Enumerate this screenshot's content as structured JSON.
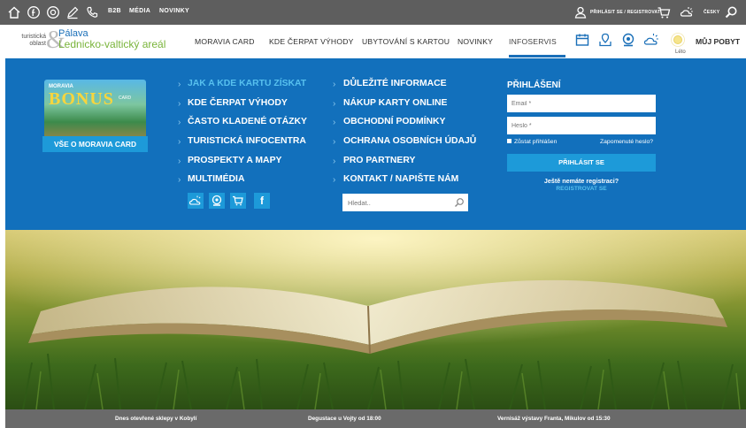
{
  "topbar": {
    "icons": [
      "home-icon",
      "facebook-icon",
      "instagram-icon",
      "pencil-icon",
      "phone-icon"
    ],
    "b2b": "B2B",
    "media": "MÉDIA",
    "novinky": "NOVINKY",
    "login_register": "PŘIHLÁSIT SE / REGISTROVAT",
    "weather_lang": "ČESKY"
  },
  "header": {
    "logo_small_1": "turistická",
    "logo_small_2": "oblast",
    "logo_amp": "&",
    "logo_line1": "Pálava",
    "logo_line2": "Lednicko-valtický areál",
    "nav": [
      "MORAVIA CARD",
      "KDE ČERPAT VÝHODY",
      "UBYTOVÁNÍ S KARTOU",
      "NOVINKY",
      "INFOSERVIS"
    ],
    "season": "Léto",
    "my_stay": "MŮJ POBYT"
  },
  "mega": {
    "card": {
      "top": "MORAVIA",
      "bonus": "BONUS",
      "caro": "CARD",
      "caption": "VŠE O MORAVIA CARD"
    },
    "col1": [
      "JAK A KDE KARTU ZÍSKAT",
      "KDE ČERPAT VÝHODY",
      "ČASTO KLADENÉ OTÁZKY",
      "TURISTICKÁ INFOCENTRA",
      "PROSPEKTY A MAPY",
      "MULTIMÉDIA"
    ],
    "col2": [
      "DŮLEŽITÉ INFORMACE",
      "NÁKUP KARTY ONLINE",
      "OBCHODNÍ PODMÍNKY",
      "OCHRANA OSOBNÍCH ÚDAJŮ",
      "PRO PARTNERY",
      "KONTAKT / NAPIŠTE NÁM"
    ],
    "social_icons": [
      "weather-icon",
      "webcam-icon",
      "cart-icon",
      "facebook-icon"
    ],
    "facebook_glyph": "f",
    "search_placeholder": "Hledat..",
    "login": {
      "title": "PŘIHLÁŠENÍ",
      "email_placeholder": "Email *",
      "password_placeholder": "Heslo *",
      "remember": "Zůstat přihlášen",
      "forgot": "Zapomenuté heslo?",
      "button": "PŘIHLÁSIT SE",
      "no_account": "Ještě nemáte registraci?",
      "register": "REGISTROVAT SE"
    }
  },
  "ticker": [
    "Dnes otevřené sklepy v Kobylí",
    "Degustace u Vojty od 18:00",
    "Vernisáž výstavy Franta, Mikulov od 15:30"
  ],
  "colors": {
    "topbar": "#5e5e5e",
    "menu_bg": "#1270bc",
    "accent": "#1d9ad9",
    "highlight": "#57c0ee",
    "logo_blue": "#1a6fb8",
    "logo_green": "#79b43a"
  }
}
